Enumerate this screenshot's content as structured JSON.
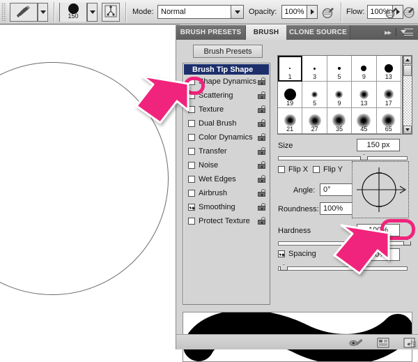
{
  "options_bar": {
    "tool_icon": "paintbrush-icon",
    "brush_size_label": "150",
    "brush_panel_toggle_icon": "brush-panel-toggle-icon",
    "mode_label": "Mode:",
    "mode_value": "Normal",
    "opacity_label": "Opacity:",
    "opacity_value": "100%",
    "opacity_pressure_icon": "tablet-pressure-opacity-icon",
    "flow_label": "Flow:",
    "flow_value": "100%",
    "airbrush_icon": "airbrush-icon",
    "flow_pressure_icon": "tablet-pressure-flow-icon"
  },
  "panel": {
    "tabs": [
      {
        "label": "BRUSH PRESETS",
        "active": false
      },
      {
        "label": "BRUSH",
        "active": true
      },
      {
        "label": "CLONE SOURCE",
        "active": false
      }
    ],
    "collapse_icon": "double-chevron-right-icon",
    "menu_icon": "panel-menu-icon",
    "presets_button": "Brush Presets",
    "options_header": "Brush Tip Shape",
    "options": [
      {
        "label": "Shape Dynamics",
        "checked": false,
        "locked": true
      },
      {
        "label": "Scattering",
        "checked": false,
        "locked": true
      },
      {
        "label": "Texture",
        "checked": false,
        "locked": true
      },
      {
        "label": "Dual Brush",
        "checked": false,
        "locked": true
      },
      {
        "label": "Color Dynamics",
        "checked": false,
        "locked": true
      },
      {
        "label": "Transfer",
        "checked": false,
        "locked": true
      },
      {
        "label": "Noise",
        "checked": false,
        "locked": true
      },
      {
        "label": "Wet Edges",
        "checked": false,
        "locked": true
      },
      {
        "label": "Airbrush",
        "checked": false,
        "locked": true
      },
      {
        "label": "Smoothing",
        "checked": true,
        "locked": true
      },
      {
        "label": "Protect Texture",
        "checked": false,
        "locked": true
      }
    ],
    "brush_grid": {
      "selected_index": 0,
      "rows": [
        [
          {
            "size": "1",
            "dot": 2,
            "soft": false
          },
          {
            "size": "3",
            "dot": 3,
            "soft": false
          },
          {
            "size": "5",
            "dot": 4,
            "soft": false
          },
          {
            "size": "9",
            "dot": 8,
            "soft": false
          },
          {
            "size": "13",
            "dot": 12,
            "soft": false
          }
        ],
        [
          {
            "size": "19",
            "dot": 17,
            "soft": false
          },
          {
            "size": "5",
            "dot": 3,
            "soft": true
          },
          {
            "size": "9",
            "dot": 5,
            "soft": true
          },
          {
            "size": "13",
            "dot": 7,
            "soft": true
          },
          {
            "size": "17",
            "dot": 8,
            "soft": true
          }
        ],
        [
          {
            "size": "21",
            "dot": 11,
            "soft": true
          },
          {
            "size": "27",
            "dot": 12,
            "soft": true
          },
          {
            "size": "35",
            "dot": 13,
            "soft": true
          },
          {
            "size": "45",
            "dot": 14,
            "soft": true
          },
          {
            "size": "65",
            "dot": 13,
            "soft": true
          }
        ]
      ],
      "scroll_up_icon": "scroll-up-arrow-icon",
      "scroll_down_icon": "scroll-down-arrow-icon"
    },
    "size": {
      "label": "Size",
      "value": "150 px",
      "slider_percent": 66
    },
    "flip_x": {
      "label": "Flip X",
      "checked": false
    },
    "flip_y": {
      "label": "Flip Y",
      "checked": false
    },
    "angle": {
      "label": "Angle:",
      "value": "0°"
    },
    "roundness": {
      "label": "Roundness:",
      "value": "100%"
    },
    "hardness": {
      "label": "Hardness",
      "value": "100%",
      "slider_percent": 100
    },
    "spacing": {
      "label": "Spacing",
      "value": "10%",
      "checked": true,
      "slider_percent": 5
    },
    "angle_preview_icon": "brush-angle-roundness-dial-icon",
    "preview_stroke_icon": "brush-stroke-preview",
    "status_icons": [
      "toggle-brush-preview-icon",
      "new-preset-page-icon",
      "new-brush-preset-icon"
    ],
    "resize_grip_icon": "resize-grip-icon"
  },
  "annotations": {
    "arrow_color": "#f0247c",
    "ring_color": "#f0247c",
    "arrow_shape_icon": "pink-pointer-arrow-icon",
    "ring_shape_icon": "pink-highlight-ring-icon",
    "targets": [
      "shape-dynamics-checkbox",
      "spacing-value-field"
    ]
  },
  "canvas": {
    "shape_icon": "circle-outline-shape"
  }
}
